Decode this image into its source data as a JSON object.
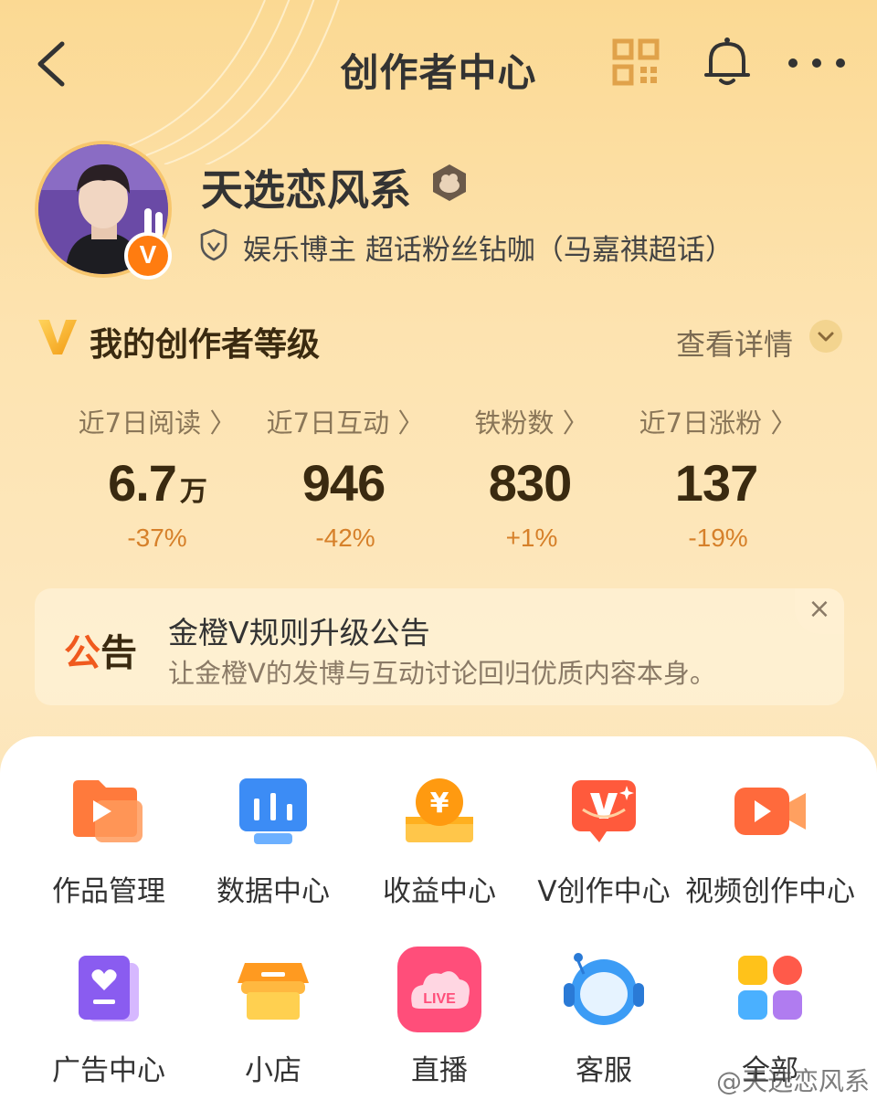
{
  "header": {
    "title": "创作者中心",
    "back_icon": "chevron-left-icon",
    "qr_icon": "qr-code-icon",
    "bell_icon": "bell-icon",
    "more_icon": "more-dots-icon"
  },
  "profile": {
    "name": "天选恋风系",
    "verified_badge": "V",
    "certification": "娱乐博主 超话粉丝钻咖（马嘉祺超话）"
  },
  "level": {
    "title": "我的创作者等级",
    "detail_link": "查看详情"
  },
  "stats": [
    {
      "label": "近7日阅读 〉",
      "value": "6.7",
      "unit": "万",
      "change": "-37%"
    },
    {
      "label": "近7日互动 〉",
      "value": "946",
      "unit": "",
      "change": "-42%"
    },
    {
      "label": "铁粉数 〉",
      "value": "830",
      "unit": "",
      "change": "+1%"
    },
    {
      "label": "近7日涨粉 〉",
      "value": "137",
      "unit": "",
      "change": "-19%"
    }
  ],
  "notice": {
    "tag_first": "公",
    "tag_second": "告",
    "title": "金橙V规则升级公告",
    "desc": "让金橙V的发博与互动讨论回归优质内容本身。",
    "close": "×"
  },
  "tools": [
    {
      "label": "作品管理",
      "icon": "folder-play-icon"
    },
    {
      "label": "数据中心",
      "icon": "data-chart-icon"
    },
    {
      "label": "收益中心",
      "icon": "yuan-coin-icon"
    },
    {
      "label": "V创作中心",
      "icon": "v-create-icon"
    },
    {
      "label": "视频创作中心",
      "icon": "video-camera-icon"
    },
    {
      "label": "广告中心",
      "icon": "ad-heart-icon"
    },
    {
      "label": "小店",
      "icon": "shop-icon"
    },
    {
      "label": "直播",
      "icon": "live-icon"
    },
    {
      "label": "客服",
      "icon": "customer-service-icon"
    },
    {
      "label": "全部",
      "icon": "all-grid-icon"
    }
  ],
  "watermark": "@天选恋风系",
  "colors": {
    "accent": "#ff7c10",
    "change": "#d6802a",
    "background": "#fbe1a8"
  }
}
